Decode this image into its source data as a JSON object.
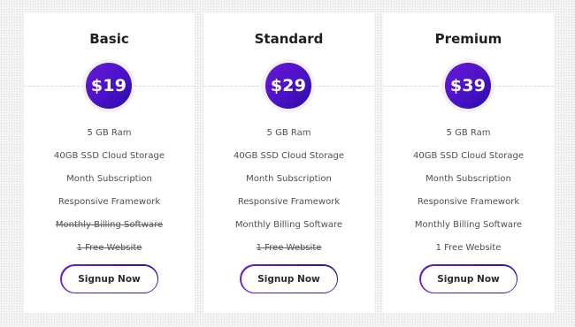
{
  "colors": {
    "accent_start": "#6a18d6",
    "accent_end": "#2a0ba8",
    "card_bg": "#ffffff",
    "page_bg": "#f4f4f6"
  },
  "plans": [
    {
      "title": "Basic",
      "price": "$19",
      "features": [
        {
          "text": "5 GB Ram",
          "strikethrough": false
        },
        {
          "text": "40GB SSD Cloud Storage",
          "strikethrough": false
        },
        {
          "text": "Month Subscription",
          "strikethrough": false
        },
        {
          "text": "Responsive Framework",
          "strikethrough": false
        },
        {
          "text": "Monthly Billing Software",
          "strikethrough": true
        },
        {
          "text": "1 Free Website",
          "strikethrough": true
        }
      ],
      "button_label": "Signup Now"
    },
    {
      "title": "Standard",
      "price": "$29",
      "features": [
        {
          "text": "5 GB Ram",
          "strikethrough": false
        },
        {
          "text": "40GB SSD Cloud Storage",
          "strikethrough": false
        },
        {
          "text": "Month Subscription",
          "strikethrough": false
        },
        {
          "text": "Responsive Framework",
          "strikethrough": false
        },
        {
          "text": "Monthly Billing Software",
          "strikethrough": false
        },
        {
          "text": "1 Free Website",
          "strikethrough": true
        }
      ],
      "button_label": "Signup Now"
    },
    {
      "title": "Premium",
      "price": "$39",
      "features": [
        {
          "text": "5 GB Ram",
          "strikethrough": false
        },
        {
          "text": "40GB SSD Cloud Storage",
          "strikethrough": false
        },
        {
          "text": "Month Subscription",
          "strikethrough": false
        },
        {
          "text": "Responsive Framework",
          "strikethrough": false
        },
        {
          "text": "Monthly Billing Software",
          "strikethrough": false
        },
        {
          "text": "1 Free Website",
          "strikethrough": false
        }
      ],
      "button_label": "Signup Now"
    }
  ]
}
